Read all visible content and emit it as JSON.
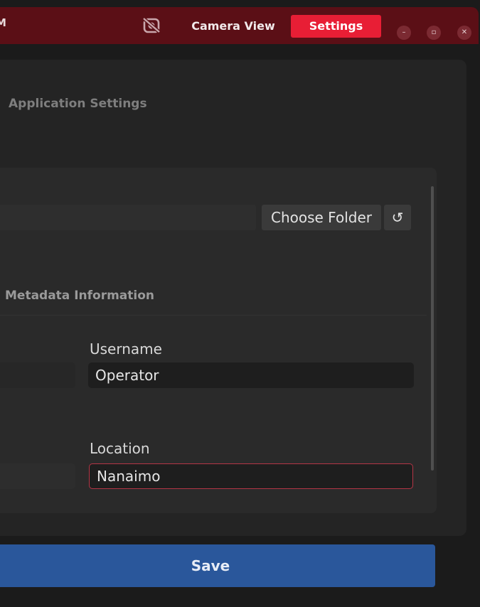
{
  "window": {
    "title_fragment": "M",
    "logo_icon": "camera-off-icon"
  },
  "nav": {
    "tabs": [
      {
        "label": "Camera View",
        "active": false
      },
      {
        "label": "Settings",
        "active": true
      }
    ]
  },
  "window_controls": {
    "minimize_icon": "minimize-icon",
    "maximize_icon": "maximize-icon",
    "close_icon": "close-icon"
  },
  "settings": {
    "heading": "Application Settings",
    "folder": {
      "choose_label": "Choose Folder",
      "reset_glyph": "↺",
      "reset_icon": "reset-icon"
    },
    "metadata": {
      "heading": "Metadata Information",
      "username": {
        "label": "Username",
        "value": "Operator"
      },
      "location": {
        "label": "Location",
        "value": "Nanaimo"
      }
    },
    "save_label": "Save"
  },
  "colors": {
    "titlebar": "#5b0f16",
    "active_tab": "#e81e35",
    "save_button": "#2a579b",
    "focused_border": "#b43546"
  }
}
